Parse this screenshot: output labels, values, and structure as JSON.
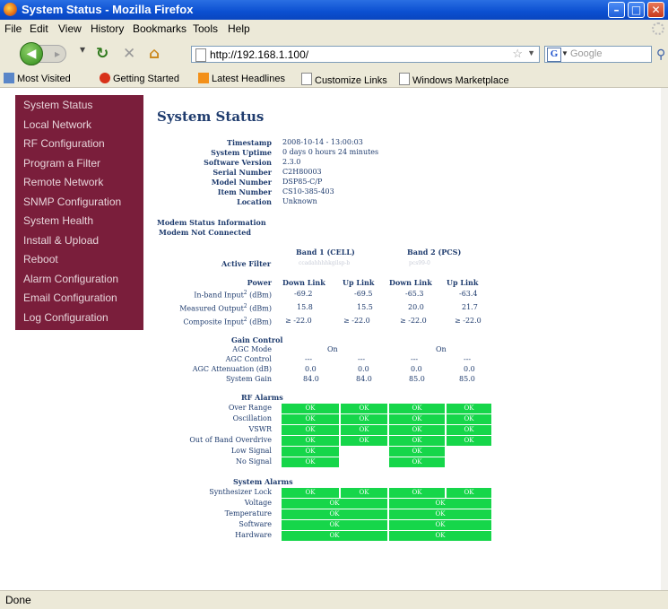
{
  "window": {
    "title": "System Status - Mozilla Firefox"
  },
  "menu": [
    "File",
    "Edit",
    "View",
    "History",
    "Bookmarks",
    "Tools",
    "Help"
  ],
  "nav": {
    "url": "http://192.168.1.100/",
    "search_placeholder": "Google"
  },
  "bookmarks": [
    "Most Visited",
    "Getting Started",
    "Latest Headlines",
    "Customize Links",
    "Windows Marketplace"
  ],
  "sidebar": [
    "System Status",
    "Local Network",
    "RF Configuration",
    "Program a Filter",
    "Remote Network",
    "SNMP Configuration",
    "System Health",
    "Install & Upload",
    "Reboot",
    "Alarm Configuration",
    "Email Configuration",
    "Log Configuration"
  ],
  "page": {
    "title": "System Status",
    "info": [
      {
        "label": "Timestamp",
        "value": "2008-10-14 - 13:00:03"
      },
      {
        "label": "System Uptime",
        "value": "0 days 0 hours 24 minutes"
      },
      {
        "label": "Software Version",
        "value": "2.3.0"
      },
      {
        "label": "Serial Number",
        "value": "C2H80003"
      },
      {
        "label": "Model Number",
        "value": "DSP85-C/P"
      },
      {
        "label": "Item Number",
        "value": "CS10-385-403"
      },
      {
        "label": "Location",
        "value": "Unknown"
      }
    ],
    "modem_status": "Modem Status Information",
    "modem_connected": "Modem Not Connected",
    "band1": "Band 1 (CELL)",
    "band2": "Band 2 (PCS)",
    "active_filter_label": "Active Filter",
    "active_filter_b1": "ccadahhhhkgilsp-b",
    "active_filter_b2": "pcs99-0",
    "power_label": "Power",
    "col_headers": [
      "Down Link",
      "Up Link",
      "Down Link",
      "Up Link"
    ],
    "power_rows": [
      {
        "label": "In-band Input",
        "sup": "2",
        "unit": " (dBm)",
        "values": [
          "-69.2",
          "-69.5",
          "-65.3",
          "-63.4"
        ]
      },
      {
        "label": "Measured Output",
        "sup": "2",
        "unit": " (dBm)",
        "values": [
          "15.8",
          "15.5",
          "20.0",
          "21.7"
        ]
      },
      {
        "label": "Composite Input",
        "sup": "2",
        "unit": " (dBm)",
        "values": [
          "≥ -22.0",
          "≥ -22.0",
          "≥ -22.0",
          "≥ -22.0"
        ]
      }
    ],
    "gain_control": "Gain Control",
    "agc_mode_label": "AGC Mode",
    "agc_mode_values": [
      "On",
      "On"
    ],
    "gain_rows": [
      {
        "label": "AGC Control",
        "values": [
          "---",
          "---",
          "---",
          "---"
        ]
      },
      {
        "label": "AGC Attenuation (dB)",
        "values": [
          "0.0",
          "0.0",
          "0.0",
          "0.0"
        ]
      },
      {
        "label": "System Gain",
        "values": [
          "84.0",
          "84.0",
          "85.0",
          "85.0"
        ]
      }
    ],
    "rf_alarms_title": "RF Alarms",
    "rf_alarms": [
      {
        "label": "Over Range",
        "values": [
          "OK",
          "OK",
          "OK",
          "OK"
        ]
      },
      {
        "label": "Oscillation",
        "values": [
          "OK",
          "OK",
          "OK",
          "OK"
        ]
      },
      {
        "label": "VSWR",
        "values": [
          "OK",
          "OK",
          "OK",
          "OK"
        ]
      },
      {
        "label": "Out of Band Overdrive",
        "values": [
          "OK",
          "OK",
          "OK",
          "OK"
        ]
      },
      {
        "label": "Low Signal",
        "values": [
          "OK",
          "",
          "OK",
          ""
        ]
      },
      {
        "label": "No Signal",
        "values": [
          "OK",
          "",
          "OK",
          ""
        ]
      }
    ],
    "system_alarms_title": "System Alarms",
    "synth_lock": {
      "label": "Synthesizer Lock",
      "values": [
        "OK",
        "OK",
        "OK",
        "OK"
      ]
    },
    "system_alarms": [
      {
        "label": "Voltage",
        "values": [
          "OK",
          "OK"
        ]
      },
      {
        "label": "Temperature",
        "values": [
          "OK",
          "OK"
        ]
      },
      {
        "label": "Software",
        "values": [
          "OK",
          "OK"
        ]
      },
      {
        "label": "Hardware",
        "values": [
          "OK",
          "OK"
        ]
      }
    ]
  },
  "status": "Done",
  "colors": {
    "sidebar": "#7a1e3b",
    "ok": "#16d64a",
    "text": "#1f3c6e"
  }
}
